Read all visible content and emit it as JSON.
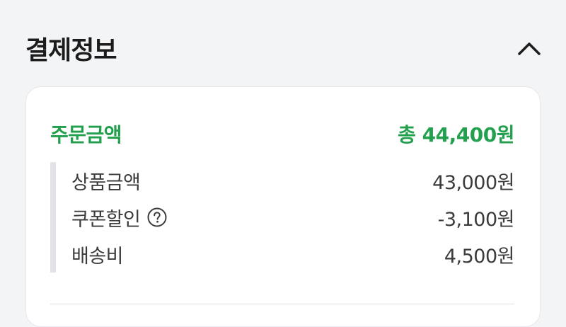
{
  "header": {
    "title": "결제정보",
    "collapse_icon": "chevron-up-icon"
  },
  "summary": {
    "label": "주문금액",
    "total": "총 44,400원",
    "accent_color": "#23a04d"
  },
  "items": [
    {
      "label": "상품금액",
      "amount": "43,000원"
    },
    {
      "label": "쿠폰할인",
      "amount": "-3,100원",
      "help_icon": "question-circle-icon"
    },
    {
      "label": "배송비",
      "amount": "4,500원"
    }
  ]
}
